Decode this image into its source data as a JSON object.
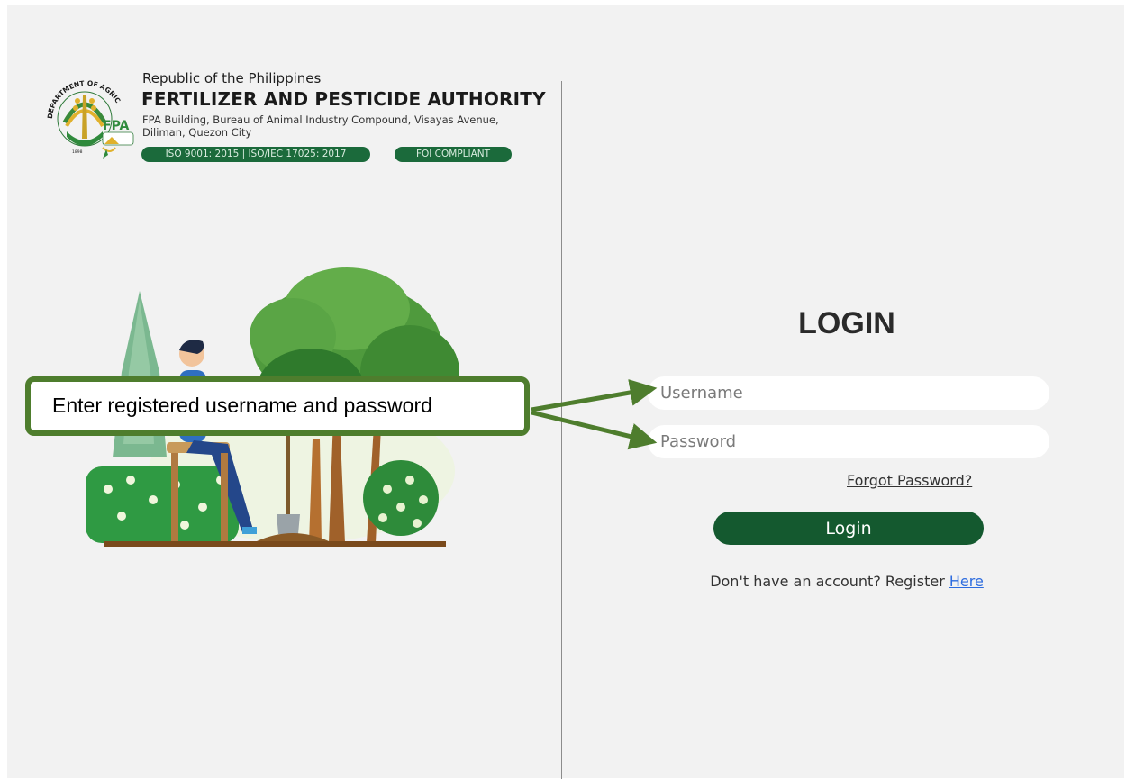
{
  "header": {
    "republic": "Republic of the Philippines",
    "agency": "FERTILIZER AND PESTICIDE AUTHORITY",
    "address": "FPA Building, Bureau of Animal Industry Compound, Visayas Avenue, Diliman, Quezon City",
    "badge_iso": "ISO 9001: 2015 | ISO/IEC 17025: 2017",
    "badge_foi": "FOI COMPLIANT",
    "logo": {
      "ring_text": "DEPARTMENT OF AGRICULTURE",
      "mark_text": "FPA",
      "year_text": "1898"
    }
  },
  "login": {
    "title": "LOGIN",
    "username_placeholder": "Username",
    "password_placeholder": "Password",
    "forgot_label": "Forgot Password?",
    "button_label": "Login",
    "register_prompt": "Don't have an account? Register ",
    "register_link": "Here"
  },
  "annotation": {
    "text": "Enter registered username and password"
  },
  "colors": {
    "brand_green": "#14592f",
    "callout_green": "#4e7d2d",
    "link_blue": "#2d6cdf",
    "panel_bg": "#f2f2f2"
  },
  "icons": {
    "emblem": "department-of-agriculture-emblem",
    "illustration": "person-sitting-with-plants-illustration"
  }
}
